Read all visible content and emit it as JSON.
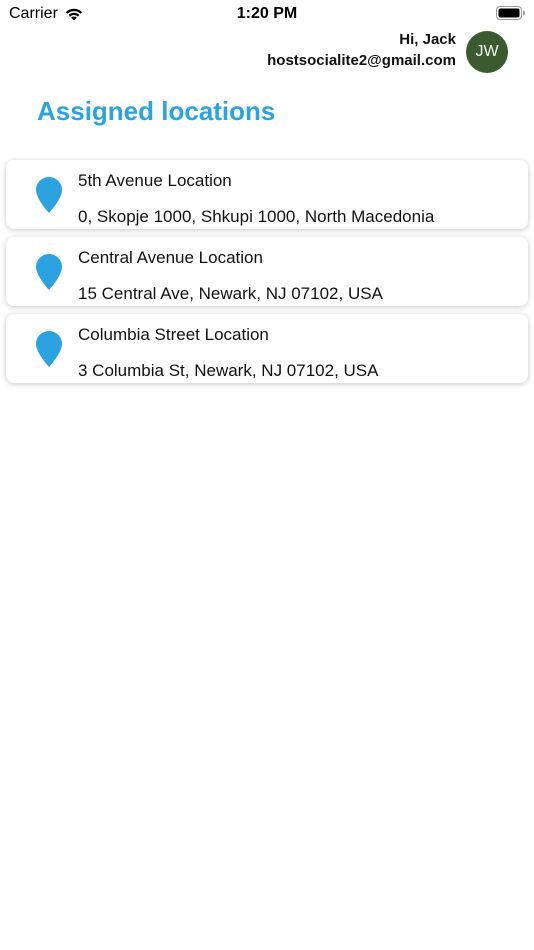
{
  "status_bar": {
    "carrier": "Carrier",
    "time": "1:20 PM"
  },
  "header": {
    "greeting": "Hi, Jack",
    "email": "hostsocialite2@gmail.com",
    "avatar_initials": "JW",
    "avatar_color": "#3b5a2e"
  },
  "page": {
    "title": "Assigned locations",
    "accent_color": "#2aa3e0"
  },
  "locations": [
    {
      "icon": "map-pin-icon",
      "name": "5th Avenue Location",
      "address": "0, Skopje 1000, Shkupi 1000, North Macedonia"
    },
    {
      "icon": "map-pin-icon",
      "name": "Central Avenue Location",
      "address": "15 Central Ave, Newark, NJ 07102, USA"
    },
    {
      "icon": "map-pin-icon",
      "name": "Columbia Street Location",
      "address": "3 Columbia St, Newark, NJ 07102, USA"
    }
  ]
}
